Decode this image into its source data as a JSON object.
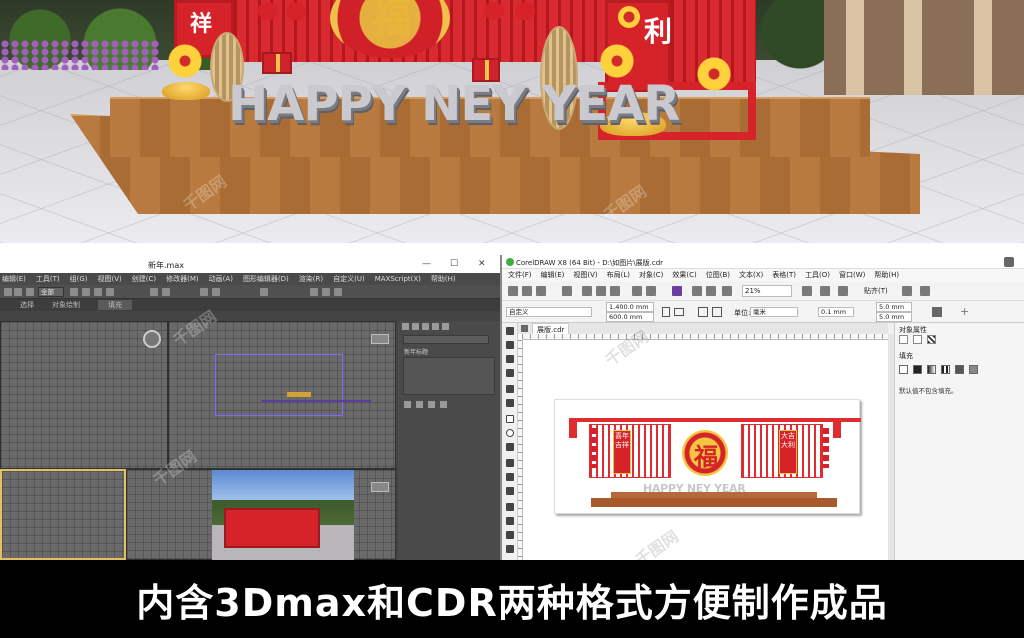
{
  "render": {
    "text_happy": "HAPPY NEY YEAR",
    "left_chars": "祥",
    "right_chars": "利",
    "center_char": "福"
  },
  "max": {
    "title": "新年.max",
    "window_controls": [
      "—",
      "☐",
      "✕"
    ],
    "menu": [
      "编辑(E)",
      "工具(T)",
      "组(G)",
      "视图(V)",
      "创建(C)",
      "修改器(M)",
      "动画(A)",
      "图形编辑器(D)",
      "渲染(R)",
      "自定义(U)",
      "MAXScript(X)",
      "帮助(H)"
    ],
    "ribbon": [
      "选择",
      "对象绘制",
      "填充"
    ],
    "toolbar_state": "全部",
    "cmd_label": "新年标题",
    "icon_names": [
      "undo-icon",
      "redo-icon",
      "link-icon",
      "select-icon",
      "move-icon",
      "rotate-icon",
      "scale-icon",
      "render-icon"
    ]
  },
  "cdr": {
    "title": "CorelDRAW X8 (64 Bit) - D:\\如图片\\展版.cdr",
    "menu": [
      "文件(F)",
      "编辑(E)",
      "视图(V)",
      "布局(L)",
      "对象(C)",
      "效果(C)",
      "位图(B)",
      "文本(X)",
      "表格(T)",
      "工具(O)",
      "窗口(W)",
      "帮助(H)"
    ],
    "zoom": "21%",
    "snap": "贴齐(T)",
    "preset": "自定义",
    "width": "1,400.0 mm",
    "height": "600.0 mm",
    "units_label": "单位:",
    "units": "毫米",
    "nudge": "0.1 mm",
    "dup_x": "5.0 mm",
    "dup_y": "5.0 mm",
    "tab": "展版.cdr",
    "docker_title": "对象属性",
    "fill_label": "填充",
    "fill_note": "默认值不包含填充。",
    "art_left": "喜年吉祥",
    "art_right": "大吉大利",
    "art_center": "福",
    "art_hny": "HAPPY NEY YEAR"
  },
  "caption": "内含3Dmax和CDR两种格式方便制作成品",
  "watermark": "千图网",
  "colors": {
    "festive_red": "#d6232a",
    "gold": "#f0c04b",
    "max_bg": "#444444",
    "cdr_bg": "#f0f0f0"
  }
}
